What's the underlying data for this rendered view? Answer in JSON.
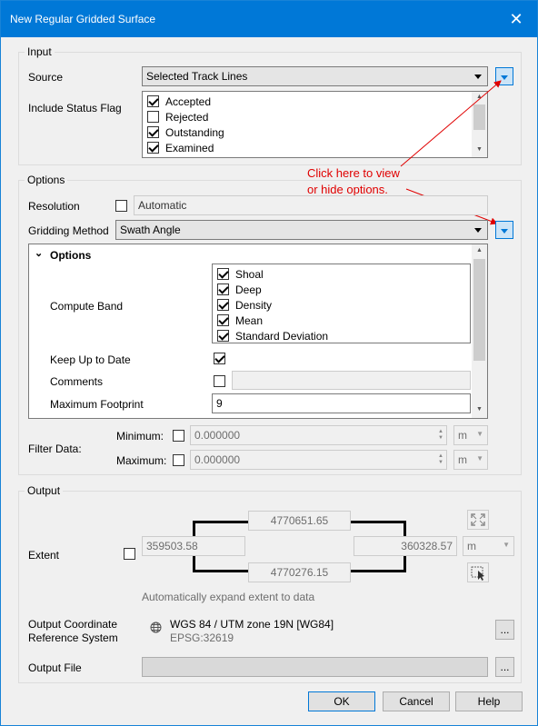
{
  "window": {
    "title": "New Regular Gridded Surface",
    "close_glyph": "✕"
  },
  "input": {
    "group_title": "Input",
    "source_label": "Source",
    "source_value": "Selected Track Lines",
    "status_label": "Include Status Flag",
    "status_items": [
      {
        "label": "Accepted",
        "checked": true
      },
      {
        "label": "Rejected",
        "checked": false
      },
      {
        "label": "Outstanding",
        "checked": true
      },
      {
        "label": "Examined",
        "checked": true
      }
    ]
  },
  "annotation": {
    "line1": "Click here to view",
    "line2": "or hide options.",
    "color": "#e00000"
  },
  "options": {
    "group_title": "Options",
    "resolution_label": "Resolution",
    "resolution_value": "Automatic",
    "gridding_label": "Gridding Method",
    "gridding_value": "Swath Angle",
    "panel_header": "Options",
    "compute_band_label": "Compute Band",
    "bands": [
      {
        "label": "Shoal",
        "checked": true
      },
      {
        "label": "Deep",
        "checked": true
      },
      {
        "label": "Density",
        "checked": true
      },
      {
        "label": "Mean",
        "checked": true
      },
      {
        "label": "Standard Deviation",
        "checked": true
      }
    ],
    "keep_up_label": "Keep Up to Date",
    "comments_label": "Comments",
    "max_footprint_label": "Maximum Footprint",
    "max_footprint_value": "9",
    "filter_label": "Filter Data:",
    "minimum_label": "Minimum:",
    "minimum_value": "0.000000",
    "maximum_label": "Maximum:",
    "maximum_value": "0.000000",
    "unit": "m"
  },
  "output": {
    "group_title": "Output",
    "extent_label": "Extent",
    "north": "4770651.65",
    "south": "4770276.15",
    "west": "359503.58",
    "east": "360328.57",
    "unit": "m",
    "auto_expand": "Automatically expand extent to data",
    "crs_label_1": "Output Coordinate",
    "crs_label_2": "Reference System",
    "crs_name": "WGS 84 / UTM zone 19N [WG84]",
    "crs_code": "EPSG:32619",
    "browse": "...",
    "output_file_label": "Output File"
  },
  "buttons": {
    "ok": "OK",
    "cancel": "Cancel",
    "help": "Help"
  }
}
